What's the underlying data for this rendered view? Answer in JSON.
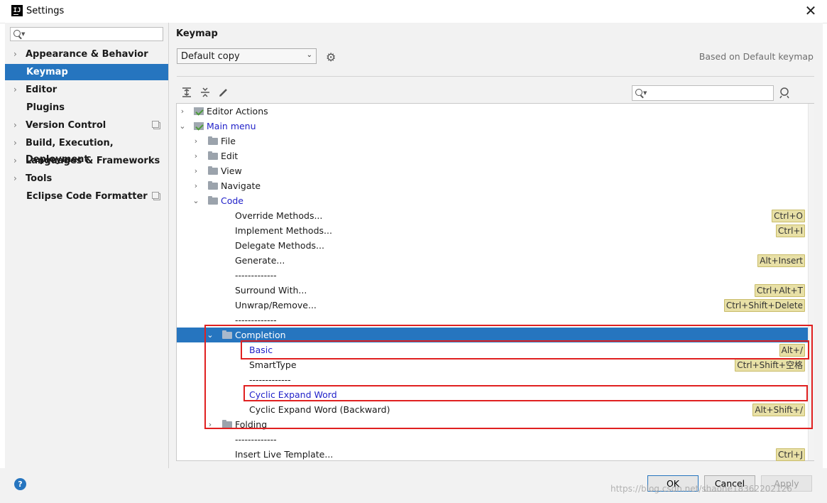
{
  "window": {
    "title": "Settings",
    "app_icon_text": "IJ",
    "close_glyph": "✕"
  },
  "sidebar": {
    "items": [
      {
        "label": "Appearance & Behavior",
        "expandable": true
      },
      {
        "label": "Keymap",
        "expandable": false,
        "selected": true
      },
      {
        "label": "Editor",
        "expandable": true
      },
      {
        "label": "Plugins",
        "expandable": false
      },
      {
        "label": "Version Control",
        "expandable": true,
        "project_icon": true
      },
      {
        "label": "Build, Execution, Deployment",
        "expandable": true
      },
      {
        "label": "Languages & Frameworks",
        "expandable": true
      },
      {
        "label": "Tools",
        "expandable": true
      },
      {
        "label": "Eclipse Code Formatter",
        "expandable": false,
        "project_icon": true
      }
    ]
  },
  "main": {
    "heading": "Keymap",
    "keymap_select": "Default copy",
    "based_on": "Based on Default keymap"
  },
  "tree": {
    "rows": [
      {
        "label": "Editor Actions",
        "shortcut": ""
      },
      {
        "label": "Main menu",
        "shortcut": ""
      },
      {
        "label": "File",
        "shortcut": ""
      },
      {
        "label": "Edit",
        "shortcut": ""
      },
      {
        "label": "View",
        "shortcut": ""
      },
      {
        "label": "Navigate",
        "shortcut": ""
      },
      {
        "label": "Code",
        "shortcut": ""
      },
      {
        "label": "Override Methods...",
        "shortcut": "Ctrl+O"
      },
      {
        "label": "Implement Methods...",
        "shortcut": "Ctrl+I"
      },
      {
        "label": "Delegate Methods...",
        "shortcut": ""
      },
      {
        "label": "Generate...",
        "shortcut": "Alt+Insert"
      },
      {
        "label": "-------------",
        "shortcut": ""
      },
      {
        "label": "Surround With...",
        "shortcut": "Ctrl+Alt+T"
      },
      {
        "label": "Unwrap/Remove...",
        "shortcut": "Ctrl+Shift+Delete"
      },
      {
        "label": "-------------",
        "shortcut": ""
      },
      {
        "label": "Completion",
        "shortcut": ""
      },
      {
        "label": "Basic",
        "shortcut": "Alt+/"
      },
      {
        "label": "SmartType",
        "shortcut": "Ctrl+Shift+空格"
      },
      {
        "label": "-------------",
        "shortcut": ""
      },
      {
        "label": "Cyclic Expand Word",
        "shortcut": ""
      },
      {
        "label": "Cyclic Expand Word (Backward)",
        "shortcut": "Alt+Shift+/"
      },
      {
        "label": "Folding",
        "shortcut": ""
      },
      {
        "label": "-------------",
        "shortcut": ""
      },
      {
        "label": "Insert Live Template...",
        "shortcut": "Ctrl+J"
      }
    ]
  },
  "footer": {
    "ok": "OK",
    "cancel": "Cancel",
    "apply": "Apply",
    "help": "?",
    "watermark": "https://blog.csdn.net/shaohe18362202126"
  },
  "colors": {
    "selection": "#2675bf",
    "link_blue": "#2121c9",
    "shortcut_bg": "#e8e0a6",
    "highlight_red": "#e02020"
  }
}
